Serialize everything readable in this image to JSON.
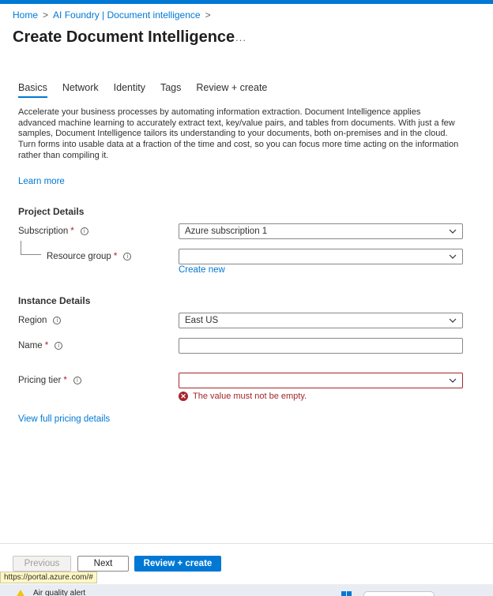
{
  "breadcrumb": {
    "home": "Home",
    "parent": "AI Foundry | Document intelligence",
    "sep": ">"
  },
  "page": {
    "title": "Create Document Intelligence",
    "more": "..."
  },
  "tabs": [
    "Basics",
    "Network",
    "Identity",
    "Tags",
    "Review + create"
  ],
  "description": "Accelerate your business processes by automating information extraction. Document Intelligence applies advanced machine learning to accurately extract text, key/value pairs, and tables from documents. With just a few samples, Document Intelligence tailors its understanding to your documents, both on-premises and in the cloud. Turn forms into usable data at a fraction of the time and cost, so you can focus more time acting on the information rather than compiling it.",
  "learn_more": "Learn more",
  "project": {
    "heading": "Project Details",
    "subscription_label": "Subscription",
    "subscription_value": "Azure subscription 1",
    "resource_group_label": "Resource group",
    "resource_group_value": "",
    "create_new": "Create new"
  },
  "instance": {
    "heading": "Instance Details",
    "region_label": "Region",
    "region_value": "East US",
    "name_label": "Name",
    "name_value": "",
    "pricing_label": "Pricing tier",
    "pricing_value": "",
    "pricing_error": "The value must not be empty."
  },
  "pricing_link": "View full pricing details",
  "footer": {
    "previous": "Previous",
    "next": "Next",
    "review": "Review + create"
  },
  "status_url": "https://portal.azure.com/#",
  "taskbar": {
    "alert": "Air quality alert"
  },
  "colors": {
    "accent": "#0078d4",
    "error": "#a4262c"
  }
}
